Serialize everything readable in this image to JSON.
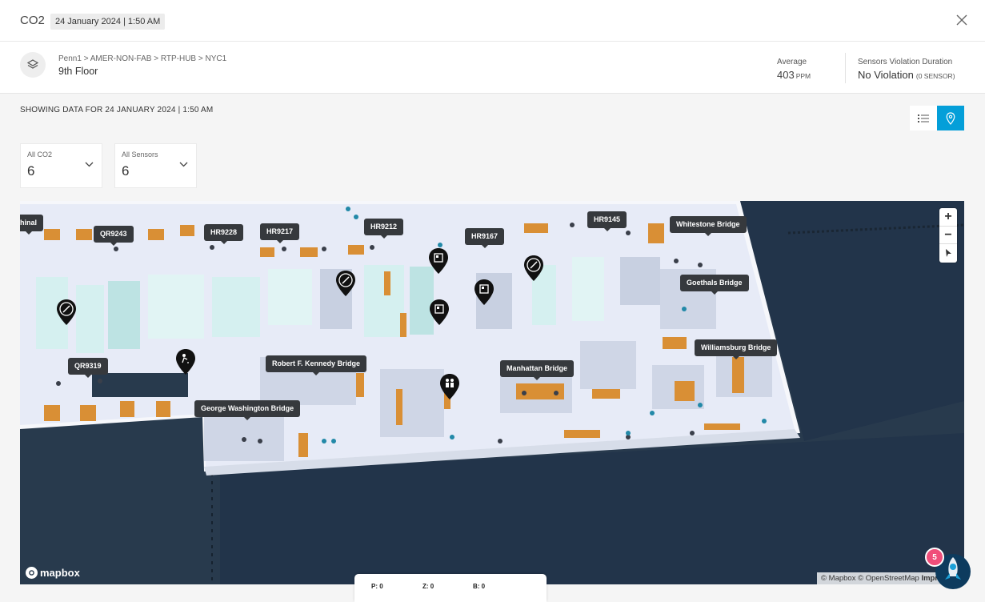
{
  "header": {
    "title": "CO2",
    "timestamp": "24 January 2024 | 1:50 AM"
  },
  "location": {
    "breadcrumb": "Penn1 > AMER-NON-FAB > RTP-HUB > NYC1",
    "floor": "9th Floor",
    "average_label": "Average",
    "average_value": "403",
    "average_unit": "PPM",
    "violation_label": "Sensors Violation Duration",
    "violation_value": "No Violation",
    "violation_sub": "(0 SENSOR)"
  },
  "content": {
    "showing_text": "SHOWING DATA FOR 24 JANUARY 2024 | 1:50 AM"
  },
  "filters": [
    {
      "label": "All CO2",
      "value": "6"
    },
    {
      "label": "All Sensors",
      "value": "6"
    }
  ],
  "map": {
    "room_labels": [
      "hinal",
      "QR9243",
      "HR9228",
      "HR9217",
      "HR9212",
      "HR9167",
      "HR9145",
      "Whitestone Bridge",
      "Goethals Bridge",
      "Williamsburg Bridge",
      "Manhattan Bridge",
      "Robert F. Kennedy Bridge",
      "QR9319",
      "George Washington Bridge"
    ],
    "zoom_in": "+",
    "zoom_out": "−",
    "logo_text": "mapbox",
    "attribution_a": "© Mapbox © OpenStreetMap",
    "attribution_b": "Improve th",
    "colors": {
      "background": "#283a4d",
      "floor": "#e7ebf7",
      "rooms": "#c8d0e1",
      "desk": "#d98f35"
    }
  },
  "status_bar": {
    "p": "P: 0",
    "z": "Z: 0",
    "b": "B: 0"
  },
  "assistant": {
    "badge": "5"
  }
}
